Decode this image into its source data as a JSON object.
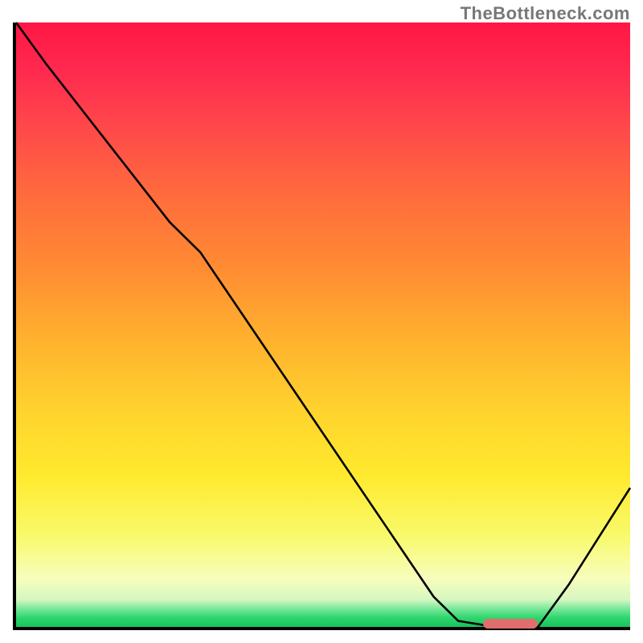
{
  "watermark": "TheBottleneck.com",
  "chart_data": {
    "type": "line",
    "title": "",
    "xlabel": "",
    "ylabel": "",
    "xlim": [
      0,
      100
    ],
    "ylim": [
      0,
      100
    ],
    "grid": false,
    "legend": false,
    "series": [
      {
        "name": "curve",
        "x": [
          0,
          5,
          15,
          25,
          30,
          40,
          50,
          60,
          68,
          72,
          78,
          85,
          90,
          100
        ],
        "y": [
          100,
          93,
          80,
          67,
          62,
          47,
          32,
          17,
          5,
          1,
          0,
          0,
          7,
          23
        ]
      }
    ],
    "marker": {
      "x_start": 76,
      "x_end": 85,
      "y": 0
    },
    "background_gradient": {
      "direction": "top-to-bottom",
      "stops": [
        {
          "pct": 0,
          "color": "#ff1744"
        },
        {
          "pct": 18,
          "color": "#ff4a4a"
        },
        {
          "pct": 40,
          "color": "#ff8a33"
        },
        {
          "pct": 64,
          "color": "#ffd22e"
        },
        {
          "pct": 85,
          "color": "#f8fa6c"
        },
        {
          "pct": 95.5,
          "color": "#d6f7c0"
        },
        {
          "pct": 100,
          "color": "#17c25c"
        }
      ]
    }
  }
}
